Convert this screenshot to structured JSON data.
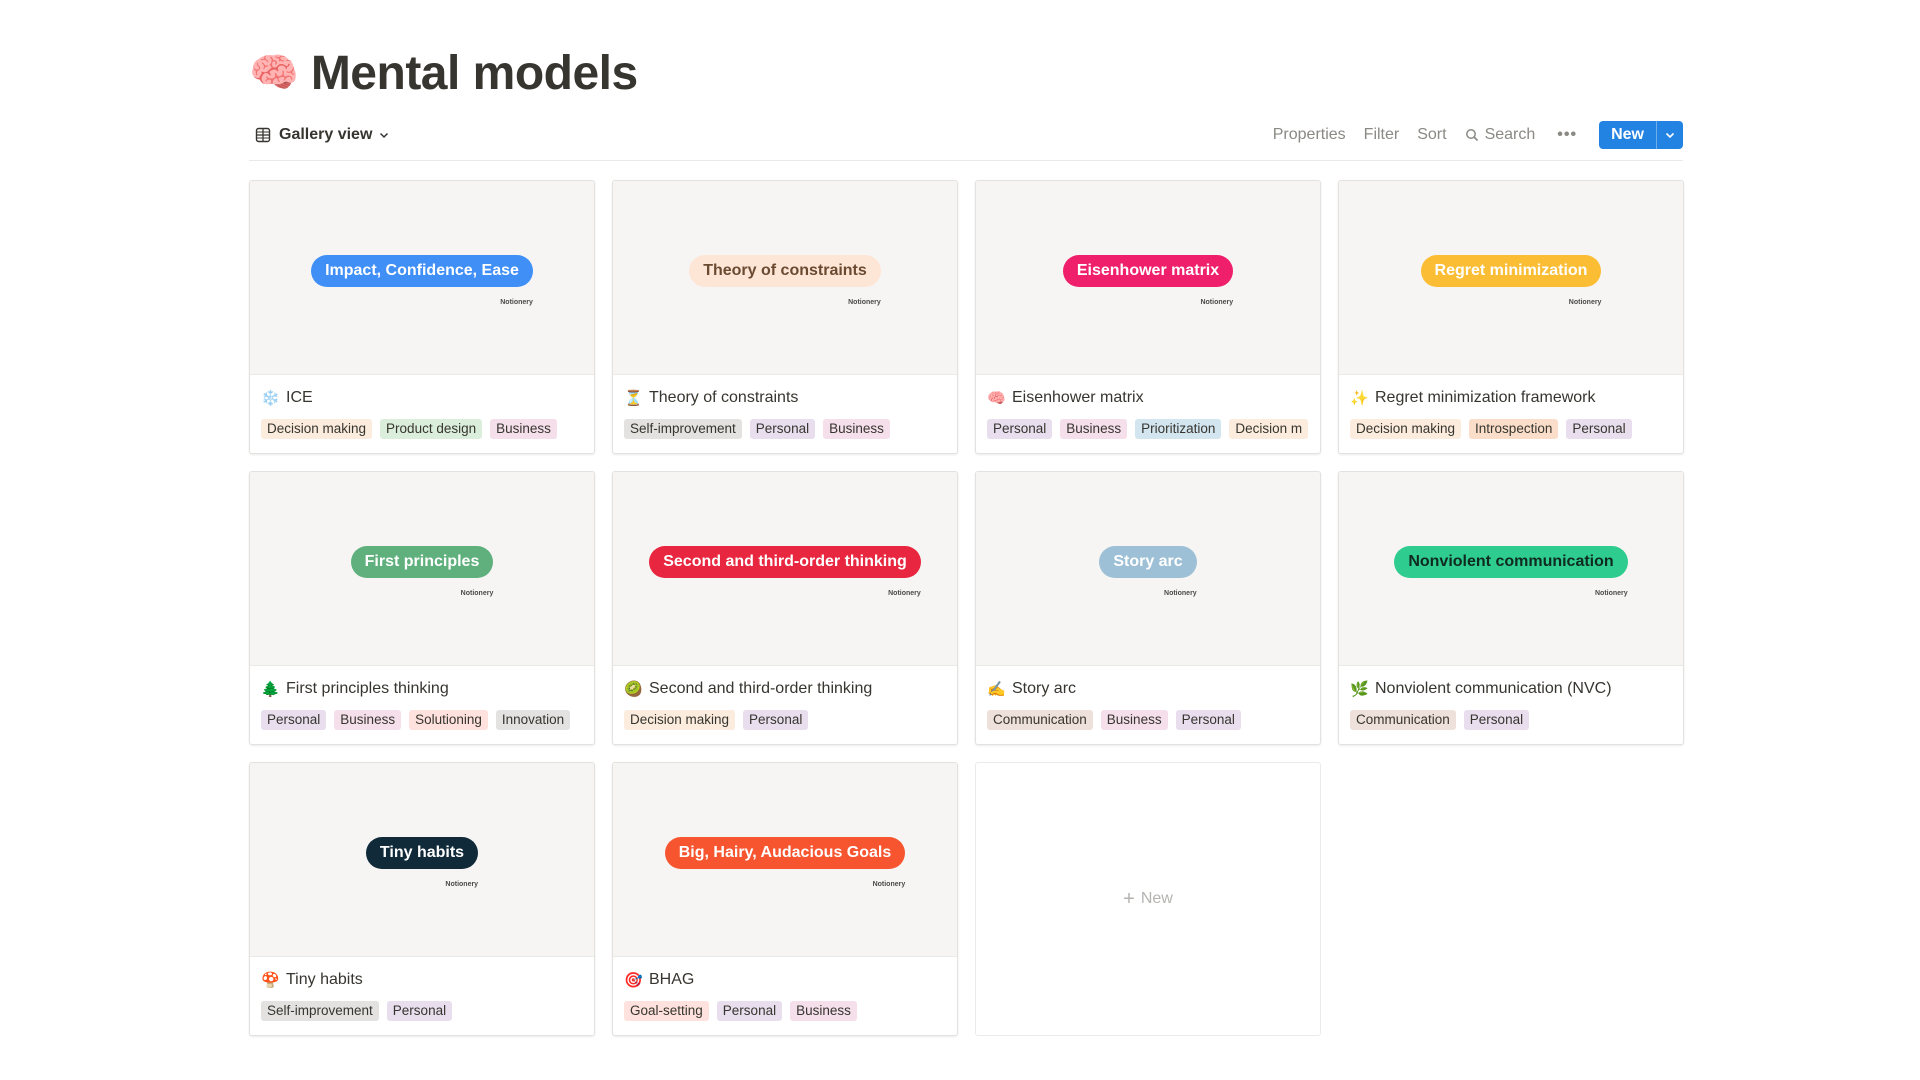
{
  "page": {
    "emoji": "🧠",
    "title": "Mental models"
  },
  "toolbar": {
    "view_label": "Gallery view",
    "properties": "Properties",
    "filter": "Filter",
    "sort": "Sort",
    "search": "Search",
    "more": "•••",
    "new_label": "New"
  },
  "cover_brand": "Notionery",
  "colors": {
    "accent": "#2383e2",
    "tag_decision_making": "#fbecdd",
    "tag_product_design": "#dbeddb",
    "tag_business": "#f4dfeb",
    "tag_personal": "#e8deee",
    "tag_self_improvement": "#e3e2e0",
    "tag_prioritization": "#d3e5ef",
    "tag_introspection": "#fadec9",
    "tag_solutioning": "#ffe2dd",
    "tag_communication": "#eee0da",
    "tag_goal_setting": "#ffe2dd"
  },
  "cards": [
    {
      "emoji": "❄️",
      "title": "ICE",
      "cover_label": "Impact, Confidence, Ease",
      "cover_bg": "#3f8ff7",
      "cover_fg": "#ffffff",
      "tags": [
        {
          "label": "Decision making",
          "bg": "#fbecdd"
        },
        {
          "label": "Product design",
          "bg": "#dbeddb"
        },
        {
          "label": "Business",
          "bg": "#f4dfeb"
        }
      ]
    },
    {
      "emoji": "⏳",
      "title": "Theory of constraints",
      "cover_label": "Theory of constraints",
      "cover_bg": "#fde6d6",
      "cover_fg": "#6b4a32",
      "tags": [
        {
          "label": "Self-improvement",
          "bg": "#e3e2e0"
        },
        {
          "label": "Personal",
          "bg": "#e8deee"
        },
        {
          "label": "Business",
          "bg": "#f4dfeb"
        }
      ]
    },
    {
      "emoji": "🧠",
      "title": "Eisenhower matrix",
      "cover_label": "Eisenhower matrix",
      "cover_bg": "#f01f6b",
      "cover_fg": "#ffffff",
      "tags": [
        {
          "label": "Personal",
          "bg": "#e8deee"
        },
        {
          "label": "Business",
          "bg": "#f4dfeb"
        },
        {
          "label": "Prioritization",
          "bg": "#d3e5ef"
        },
        {
          "label": "Decision m",
          "bg": "#fbecdd"
        }
      ]
    },
    {
      "emoji": "✨",
      "title": "Regret minimization framework",
      "cover_label": "Regret minimization",
      "cover_bg": "#fbbd33",
      "cover_fg": "#ffffff",
      "tags": [
        {
          "label": "Decision making",
          "bg": "#fbecdd"
        },
        {
          "label": "Introspection",
          "bg": "#fadec9"
        },
        {
          "label": "Personal",
          "bg": "#e8deee"
        }
      ]
    },
    {
      "emoji": "🌲",
      "title": "First principles thinking",
      "cover_label": "First principles",
      "cover_bg": "#5fb07d",
      "cover_fg": "#ffffff",
      "tags": [
        {
          "label": "Personal",
          "bg": "#e8deee"
        },
        {
          "label": "Business",
          "bg": "#f4dfeb"
        },
        {
          "label": "Solutioning",
          "bg": "#ffe2dd"
        },
        {
          "label": "Innovation",
          "bg": "#e3e2e0"
        }
      ]
    },
    {
      "emoji": "🥝",
      "title": "Second and third-order thinking",
      "cover_label": "Second and third-order thinking",
      "cover_bg": "#e8263f",
      "cover_fg": "#ffffff",
      "tags": [
        {
          "label": "Decision making",
          "bg": "#fbecdd"
        },
        {
          "label": "Personal",
          "bg": "#e8deee"
        }
      ]
    },
    {
      "emoji": "✍️",
      "title": "Story arc",
      "cover_label": "Story arc",
      "cover_bg": "#9ec0d6",
      "cover_fg": "#ffffff",
      "tags": [
        {
          "label": "Communication",
          "bg": "#eee0da"
        },
        {
          "label": "Business",
          "bg": "#f4dfeb"
        },
        {
          "label": "Personal",
          "bg": "#e8deee"
        }
      ]
    },
    {
      "emoji": "🌿",
      "title": "Nonviolent communication (NVC)",
      "cover_label": "Nonviolent communication",
      "cover_bg": "#2fcc8f",
      "cover_fg": "#0f2a20",
      "tags": [
        {
          "label": "Communication",
          "bg": "#eee0da"
        },
        {
          "label": "Personal",
          "bg": "#e8deee"
        }
      ]
    },
    {
      "emoji": "🍄",
      "title": "Tiny habits",
      "cover_label": "Tiny habits",
      "cover_bg": "#102a3a",
      "cover_fg": "#ffffff",
      "tags": [
        {
          "label": "Self-improvement",
          "bg": "#e3e2e0"
        },
        {
          "label": "Personal",
          "bg": "#e8deee"
        }
      ]
    },
    {
      "emoji": "🎯",
      "title": "BHAG",
      "cover_label": "Big, Hairy, Audacious Goals",
      "cover_bg": "#f65530",
      "cover_fg": "#ffffff",
      "tags": [
        {
          "label": "Goal-setting",
          "bg": "#ffe2dd"
        },
        {
          "label": "Personal",
          "bg": "#e8deee"
        },
        {
          "label": "Business",
          "bg": "#f4dfeb"
        }
      ]
    }
  ],
  "new_card": {
    "label": "New"
  }
}
